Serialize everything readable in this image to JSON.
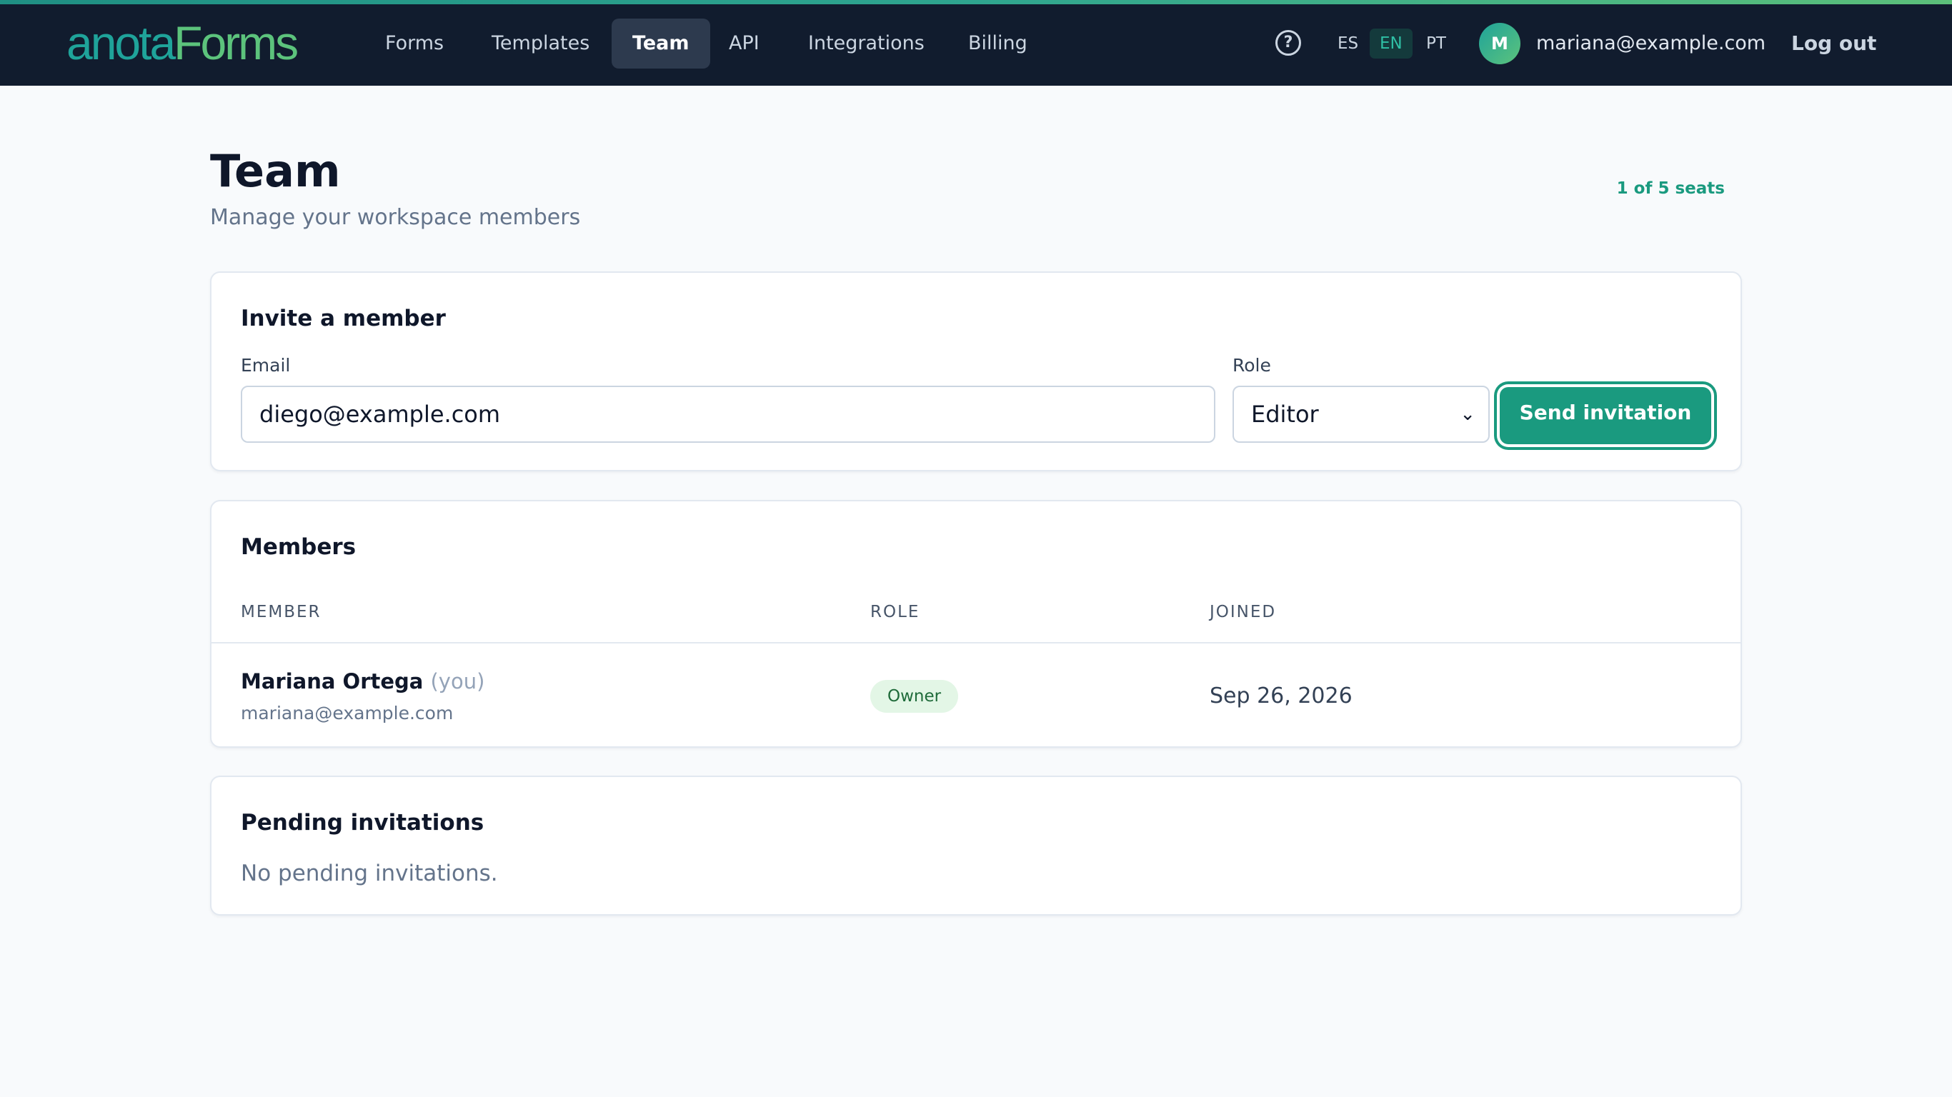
{
  "brand": {
    "logo_part1": "anota",
    "logo_part2": "Forms",
    "accent": "#1a9a7f"
  },
  "nav": {
    "items": [
      {
        "label": "Forms",
        "active": false
      },
      {
        "label": "Templates",
        "active": false
      },
      {
        "label": "Team",
        "active": true
      },
      {
        "label": "API",
        "active": false
      },
      {
        "label": "Integrations",
        "active": false
      },
      {
        "label": "Billing",
        "active": false
      }
    ]
  },
  "header": {
    "help_icon": "?",
    "languages": [
      {
        "code": "ES",
        "active": false
      },
      {
        "code": "EN",
        "active": true
      },
      {
        "code": "PT",
        "active": false
      }
    ],
    "avatar_initial": "M",
    "user_email": "mariana@example.com",
    "logout_label": "Log out"
  },
  "page": {
    "title": "Team",
    "subtitle": "Manage your workspace members",
    "seats": "1 of 5 seats"
  },
  "invite": {
    "title": "Invite a member",
    "email_label": "Email",
    "email_value": "diego@example.com",
    "role_label": "Role",
    "role_value": "Editor",
    "caret": "⌄",
    "send_label": "Send invitation"
  },
  "members": {
    "title": "Members",
    "columns": {
      "member": "MEMBER",
      "role": "ROLE",
      "joined": "JOINED"
    },
    "rows": [
      {
        "name": "Mariana Ortega",
        "you": "(you)",
        "email": "mariana@example.com",
        "role": "Owner",
        "joined": "Sep 26, 2026"
      }
    ]
  },
  "pending": {
    "title": "Pending invitations",
    "empty": "No pending invitations."
  }
}
